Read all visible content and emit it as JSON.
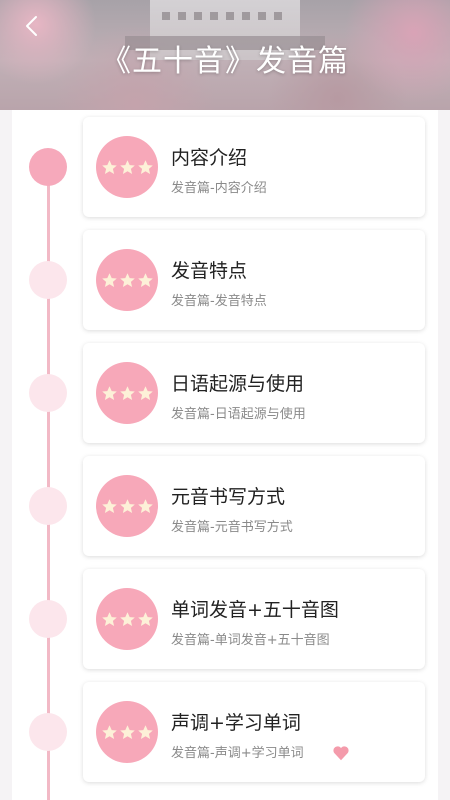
{
  "header": {
    "title": "《五十音》发音篇",
    "back_icon": "chevron-left-icon"
  },
  "colors": {
    "accent": "#f7a8b9",
    "timeline": "#f2b9c6",
    "node_inactive": "#fce6ec",
    "star": "#fdf1d8"
  },
  "lessons": [
    {
      "title": "内容介绍",
      "subtitle": "发音篇-内容介绍",
      "active": true,
      "stars": 3
    },
    {
      "title": "发音特点",
      "subtitle": "发音篇-发音特点",
      "active": false,
      "stars": 3
    },
    {
      "title": "日语起源与使用",
      "subtitle": "发音篇-日语起源与使用",
      "active": false,
      "stars": 3
    },
    {
      "title": "元音书写方式",
      "subtitle": "发音篇-元音书写方式",
      "active": false,
      "stars": 3
    },
    {
      "title": "单词发音+五十音图",
      "subtitle": "发音篇-单词发音+五十音图",
      "active": false,
      "stars": 3
    },
    {
      "title": "声调+学习单词",
      "subtitle": "发音篇-声调+学习单词",
      "active": false,
      "stars": 3
    }
  ]
}
